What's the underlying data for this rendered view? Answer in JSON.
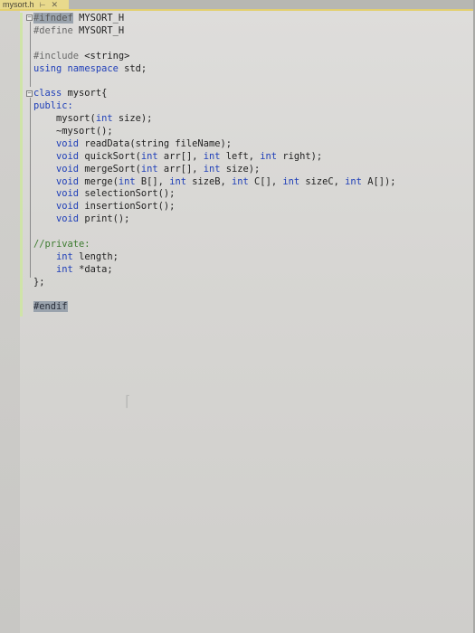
{
  "tab": {
    "filename": "mysort.h",
    "pin_icon": "pin-icon",
    "close_icon": "close-icon"
  },
  "colors": {
    "keyword": "#1f3fb8",
    "preprocessor": "#6a6a6a",
    "highlight": "#9aa3ad",
    "tab_accent": "#e8d98c",
    "change_bar": "#cfe4a8"
  },
  "code": {
    "lines": [
      "#ifndef MYSORT_H",
      "#define MYSORT_H",
      "",
      "#include <string>",
      "using namespace std;",
      "",
      "class mysort{",
      "public:",
      "    mysort(int size);",
      "    ~mysort();",
      "    void readData(string fileName);",
      "    void quickSort(int arr[], int left, int right);",
      "    void mergeSort(int arr[], int size);",
      "    void merge(int B[], int sizeB, int C[], int sizeC, int A[]);",
      "    void selectionSort();",
      "    void insertionSort();",
      "    void print();",
      "",
      "//private:",
      "    int length;",
      "    int *data;",
      "};",
      "",
      "#endif"
    ]
  }
}
